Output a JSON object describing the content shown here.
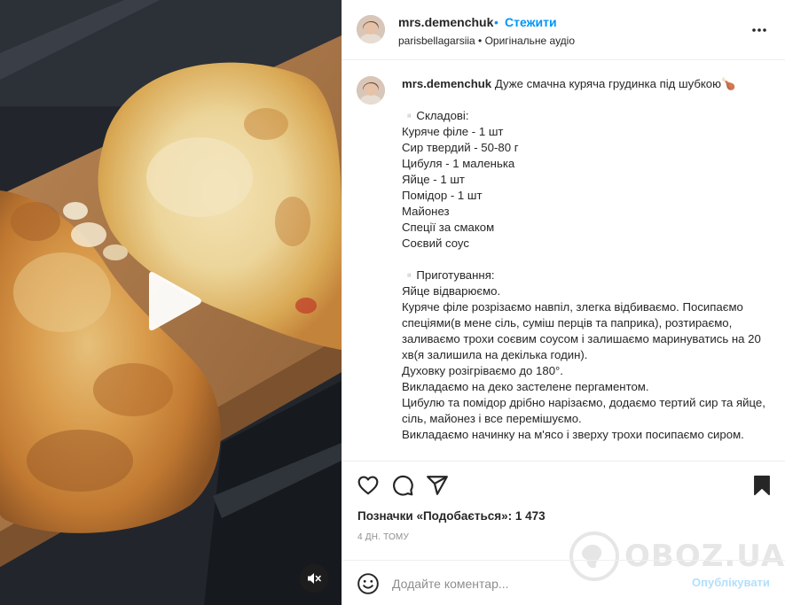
{
  "header": {
    "username": "mrs.demenchuk",
    "separator": "•",
    "follow_label": "Стежити",
    "subline": "parisbellagarsiia • Оригінальне аудіо"
  },
  "caption": {
    "username": "mrs.demenchuk",
    "title": "Дуже смачна куряча грудинка під шубкою🍗",
    "lines": [
      "▫️Складові:",
      "Куряче філе - 1 шт",
      "Сир твердий - 50-80 г",
      "Цибуля - 1 маленька",
      "Яйце - 1 шт",
      "Помідор - 1 шт",
      "Майонез",
      "Спеції за смаком",
      "Соєвий соус",
      "",
      "▫️Приготування:",
      "Яйце відварюємо.",
      "Куряче філе розрізаємо навпіл, злегка відбиваємо. Посипаємо спеціями(в мене сіль, суміш перців та паприка), розтираємо, заливаємо трохи соєвим соусом і залишаємо маринуватись на 20 хв(я залишила на декілька годин).",
      "Духовку розігріваємо до 180°.",
      "Викладаємо на деко застелене пергаментом.",
      "Цибулю та помідор дрібно нарізаємо, додаємо тертий сир та яйце, сіль, майонез і все перемішуємо.",
      "Викладаємо начинку на м'ясо і зверху трохи посипаємо сиром."
    ]
  },
  "actions": {
    "icons": [
      "heart-icon",
      "comment-icon",
      "share-icon",
      "bookmark-icon"
    ]
  },
  "likes": "Позначки «Подобається»: 1 473",
  "time": "4 ДН. ТОМУ",
  "comment": {
    "placeholder": "Додайте коментар...",
    "post_label": "Опублікувати"
  },
  "watermark": {
    "text": "OBOZ.UA"
  },
  "colors": {
    "accent": "#0095f6",
    "post_disabled": "#b2dffc",
    "border": "#efefef"
  }
}
